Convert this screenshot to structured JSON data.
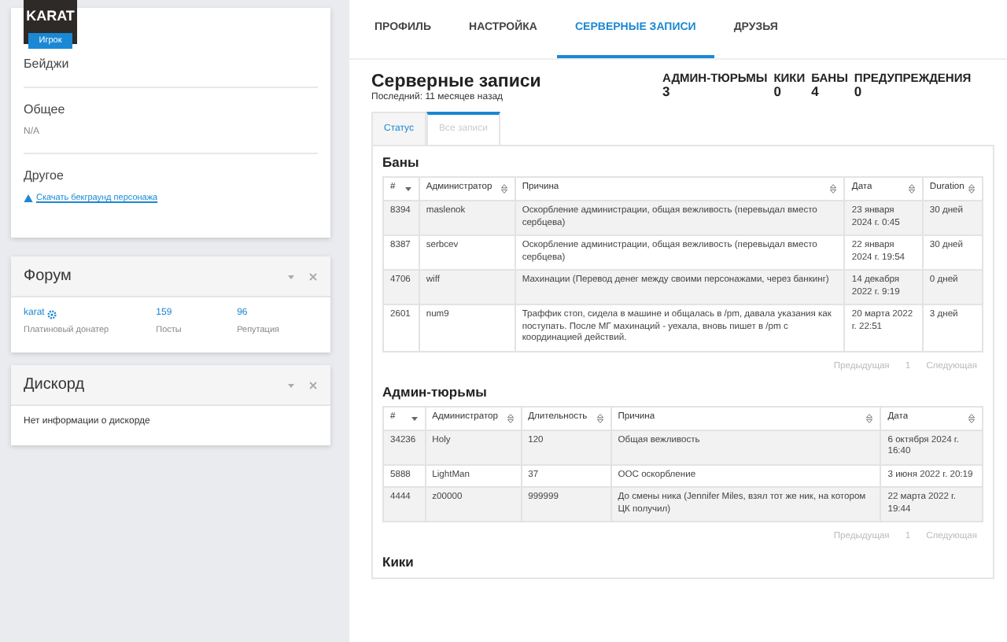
{
  "profile": {
    "name": "KARAT",
    "role": "Игрок",
    "sections": [
      {
        "title": "Бейджи"
      },
      {
        "title": "Общее",
        "text": "N/A"
      },
      {
        "title": "Другое",
        "link": "Скачать бекграунд персонажа"
      }
    ]
  },
  "forum": {
    "title": "Форум",
    "user": "karat",
    "user_rank": "Платиновый донатер",
    "stats": [
      {
        "value": "159",
        "label": "Посты"
      },
      {
        "value": "96",
        "label": "Репутация"
      }
    ]
  },
  "discord": {
    "title": "Дискорд",
    "text": "Нет информации о дискорде"
  },
  "nav_tabs": [
    {
      "label": "ПРОФИЛЬ",
      "selected": false
    },
    {
      "label": "НАСТРОЙКА",
      "selected": false
    },
    {
      "label": "СЕРВЕРНЫЕ ЗАПИСИ",
      "selected": true
    },
    {
      "label": "ДРУЗЬЯ",
      "selected": false
    }
  ],
  "records": {
    "title": "Серверные записи",
    "subtitle": "Последний: 11 месяцев назад",
    "stats": [
      {
        "label": "АДМИН-ТЮРЬМЫ",
        "value": "3"
      },
      {
        "label": "КИКИ",
        "value": "0"
      },
      {
        "label": "БАНЫ",
        "value": "4"
      },
      {
        "label": "ПРЕДУПРЕЖДЕНИЯ",
        "value": "0"
      }
    ],
    "tabs": [
      {
        "label": "Статус",
        "selected": false
      },
      {
        "label": "Все записи",
        "selected": true
      }
    ],
    "tables": [
      {
        "title": "Баны",
        "columns": [
          {
            "label": "#",
            "sorted": true
          },
          {
            "label": "Администратор",
            "sorted": false
          },
          {
            "label": "Причина",
            "sorted": false
          },
          {
            "label": "Дата",
            "sorted": false
          },
          {
            "label": "Duration",
            "sorted": false
          }
        ],
        "rows": [
          [
            "8394",
            "maslenok",
            "Оскорбление администрации, общая вежливость (перевыдал вместо сербцева)",
            "23 января 2024 г. 0:45",
            "30 дней"
          ],
          [
            "8387",
            "serbcev",
            "Оскорбление администрации, общая вежливость (перевыдал вместо сербцева)",
            "22 января 2024 г. 19:54",
            "30 дней"
          ],
          [
            "4706",
            "wiff",
            "Махинации (Перевод денег между своими персонажами, через банкинг)",
            "14 декабря 2022 г. 9:19",
            "0 дней"
          ],
          [
            "2601",
            "num9",
            "Траффик стоп, сидела в машине и общалась в /pm, давала указания как поступать. После МГ махинаций - уехала, вновь пишет в /pm с координацией действий.",
            "20 марта 2022 г. 22:51",
            "3 дней"
          ]
        ],
        "pagination": {
          "prev": "Предыдущая",
          "page": "1",
          "next": "Следующая"
        }
      },
      {
        "title": "Админ-тюрьмы",
        "columns": [
          {
            "label": "#",
            "sorted": true
          },
          {
            "label": "Администратор",
            "sorted": false
          },
          {
            "label": "Длительность",
            "sorted": false
          },
          {
            "label": "Причина",
            "sorted": false
          },
          {
            "label": "Дата",
            "sorted": false
          }
        ],
        "rows": [
          [
            "34236",
            "Holy",
            "120",
            "Общая вежливость",
            "6 октября 2024 г. 16:40"
          ],
          [
            "5888",
            "LightMan",
            "37",
            "ООС оскорбление",
            "3 июня 2022 г. 20:19"
          ],
          [
            "4444",
            "z00000",
            "999999",
            "До смены ника (Jennifer Miles, взял тот же ник, на котором ЦК получил)",
            "22 марта 2022 г. 19:44"
          ]
        ],
        "pagination": {
          "prev": "Предыдущая",
          "page": "1",
          "next": "Следующая"
        }
      }
    ],
    "next_heading": "Кики"
  }
}
